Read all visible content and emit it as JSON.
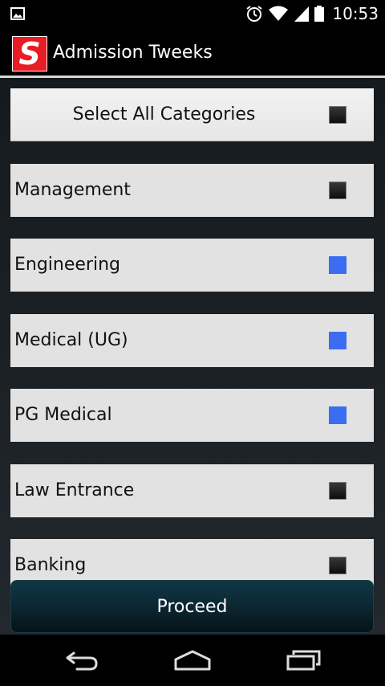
{
  "status_bar": {
    "time": "10:53",
    "icons": [
      "image-notification-icon",
      "alarm-icon",
      "wifi-icon",
      "signal-icon",
      "battery-icon"
    ]
  },
  "action_bar": {
    "logo_letter": "S",
    "title": "Admission Tweeks",
    "logo_color": "#e81c24"
  },
  "select_all": {
    "label": "Select All Categories",
    "checked": false
  },
  "categories": [
    {
      "label": "Management",
      "checked": false
    },
    {
      "label": "Engineering",
      "checked": true
    },
    {
      "label": "Medical (UG)",
      "checked": true
    },
    {
      "label": "PG Medical",
      "checked": true
    },
    {
      "label": "Law Entrance",
      "checked": false
    },
    {
      "label": "Banking",
      "checked": false
    }
  ],
  "proceed": {
    "label": "Proceed"
  },
  "colors": {
    "checked": "#3b6df0",
    "row_background": "#e2e2e2"
  },
  "nav_bar": {
    "icons": [
      "back-icon",
      "home-icon",
      "recent-apps-icon"
    ]
  }
}
